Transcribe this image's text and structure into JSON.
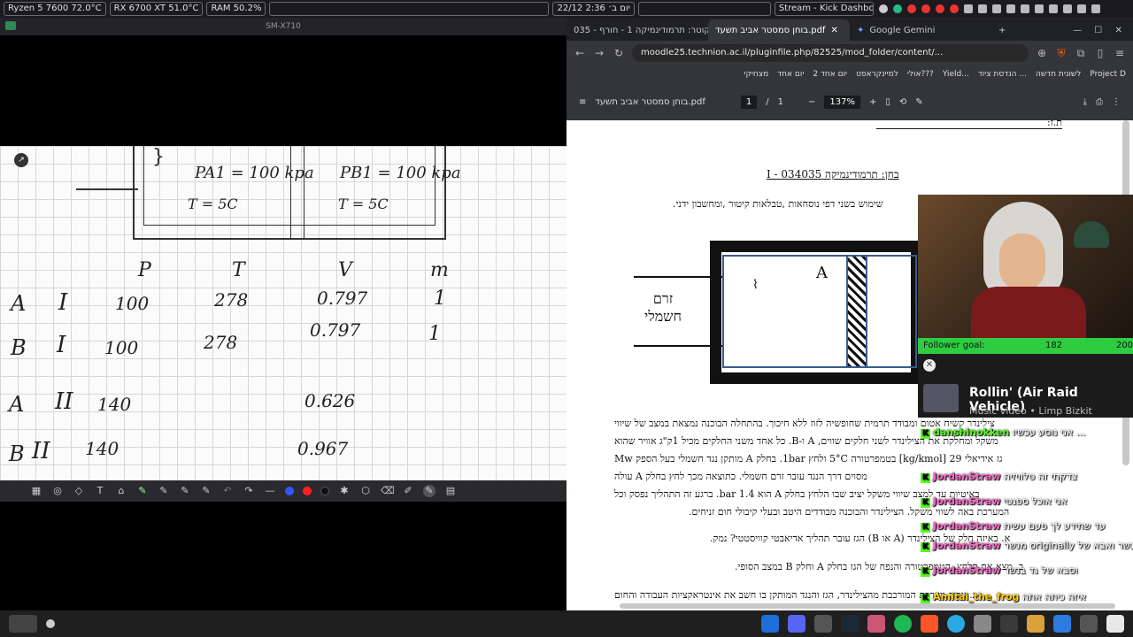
{
  "system_bar": {
    "cpu": "Ryzen 5 7600  72.0°C",
    "gpu": "RX 6700 XT  51.0°C",
    "ram": "RAM    50.2%",
    "date": "22/12 יום ב׳ 2:36",
    "stream_title": "Stream - Kick Dashboa..."
  },
  "tablet": {
    "window_title": "SM-X710",
    "table_headers": [
      "P",
      "T",
      "V",
      "m"
    ],
    "rows": [
      {
        "state": "A",
        "stage": "I",
        "P": "100",
        "T": "278",
        "V": "0.797",
        "m": "1"
      },
      {
        "state": "B",
        "stage": "I",
        "P": "100",
        "T": "278",
        "V": "0.797",
        "m": "1"
      },
      {
        "state": "A",
        "stage": "II",
        "P": "140",
        "T": "",
        "V": "0.626",
        "m": ""
      },
      {
        "state": "B",
        "stage": "II",
        "P": "140",
        "T": "",
        "V": "0.967",
        "m": ""
      }
    ],
    "diagram_left_p": "PA1 = 100 kpa",
    "diagram_left_t": "T = 5C",
    "diagram_right_p": "PB1 = 100 kpa",
    "diagram_right_t": "T = 5C"
  },
  "browser": {
    "tabs": [
      {
        "label": "קוטר: תרמודינמיקה 1 - חורף - 035"
      },
      {
        "label": "בוחן סמסטר אביב תשעד.pdf"
      },
      {
        "label": "Google Gemini"
      }
    ],
    "url": "moodle25.technion.ac.il/pluginfile.php/82525/mod_folder/content/...",
    "bookmarks": [
      "Project D",
      "לשונית חדשה",
      "הנדסת ציוד ...",
      "Yield...",
      "אולי???",
      "למיינקראפט",
      "יום אחד 2",
      "יום אחד",
      "מצחיקי"
    ],
    "pdf": {
      "filename": "בוחן סמסטר אביב תשעד.pdf",
      "page_current": "1",
      "page_total": "1",
      "zoom": "137%",
      "heading_id": "ת.ז:",
      "heading": "בחן: תרמודינמיקה I - 034035",
      "instructions": "שימוש בשני דפי נוסחאות ,טבלאות קיטור ,ומחשבון ידני.",
      "label_a": "A",
      "label_current": "זרם חשמלי",
      "paragraph": [
        "צילינדר קשיח אטום ומבודד תרמית שחופשיה לזוז ללא חיכוך. בהתחלה הבוכנה נמצאת במצב של שיווי",
        "משקל ומחלקת את הצילינדר לשני חלקים שווים, A ו-B. כל אחד משני החלקים מכיל 1ק\"ג אוויר שהוא",
        "גז אידיאלי 29 [kg/kmol] בטמפרטורה 5°C ולחץ 1bar. בחלק A מותקן נגד חשמלי בעל הספק Mw",
        "מסוים דרך הנגד עובר זרם חשמלי. כתוצאה מכך לחץ בחלק A עולה",
        "באיטיות עד למצב שיווי משקל יציב שבו הלחץ בחלק A הוא 1.4 bar. ברגע זה התהליך נפסק וכל",
        "המערכת באה לשווי משקל. הצילינדר והבוכנה מבודדים היטב ובעלי קיבולי חום זניחים."
      ],
      "q_a": "א. באיזה חלק של הצילינדר (A או B) הגז עובר תהליך אדיאבטי קוויסטטי? נמק.",
      "q_b": "ב. מצא את הלחץ, הטמפרטורה והנפח של הגז בחלק A וחלק B במצב הסופי.",
      "q_c": "ג. עבור מערכת המורכבת מהצילינדר, הגז והנגד המותקן בו חשב את אינטראקציות העבודה והחום"
    }
  },
  "overlay": {
    "follower_goal_label": "Follower goal:",
    "follower_current": "182",
    "follower_target": "200",
    "follower_progress": 0.91,
    "song_title": "Rollin' (Air Raid Vehicle)",
    "song_sub": "Music video • Limp Bizkit",
    "chat": [
      {
        "user": "danshinokken",
        "msg": "אני נוסע עכשיו ...",
        "color": "#53fc18"
      },
      {
        "user": "JordanStraw",
        "msg": "צדקתי זה טלוויזיה",
        "color": "#ff66cc"
      },
      {
        "user": "JordanStraw",
        "msg": "אני אוכל ספגטי",
        "color": "#ff66cc"
      },
      {
        "user": "JordanStraw",
        "msg": "עד שתידע לך פעם עשית",
        "color": "#ff66cc"
      },
      {
        "user": "JordanStraw",
        "msg": "מנשר originally מימונה בנשר ואבא של",
        "color": "#ff66cc"
      },
      {
        "user": "JordanStraw",
        "msg": "וסבא של גד בנשר",
        "color": "#ff66cc"
      },
      {
        "user": "Amitai_the_frog",
        "msg": "איזה כיתה אתה",
        "color": "#ffcc00"
      }
    ]
  },
  "colors": {
    "kick_green": "#53fc18",
    "goal_green": "#2ecc40",
    "pen_blue": "#3355ff",
    "pen_red": "#ff2020"
  }
}
